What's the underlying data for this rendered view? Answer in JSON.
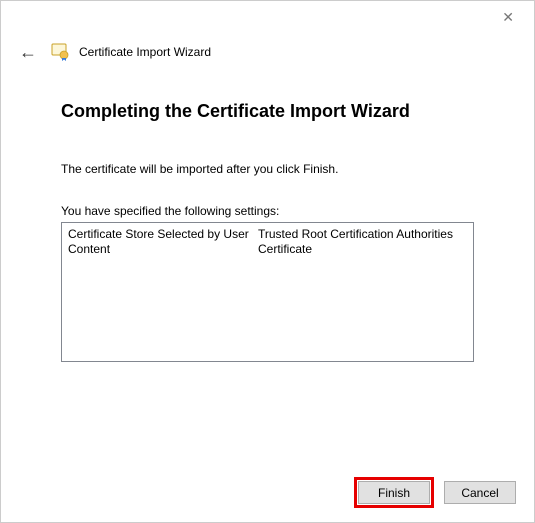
{
  "window": {
    "title": "Certificate Import Wizard"
  },
  "main": {
    "heading": "Completing the Certificate Import Wizard",
    "description": "The certificate will be imported after you click Finish.",
    "settings_label": "You have specified the following settings:",
    "settings": [
      {
        "key": "Certificate Store Selected by User",
        "value": "Trusted Root Certification Authorities"
      },
      {
        "key": "Content",
        "value": "Certificate"
      }
    ]
  },
  "footer": {
    "finish_label": "Finish",
    "cancel_label": "Cancel"
  }
}
